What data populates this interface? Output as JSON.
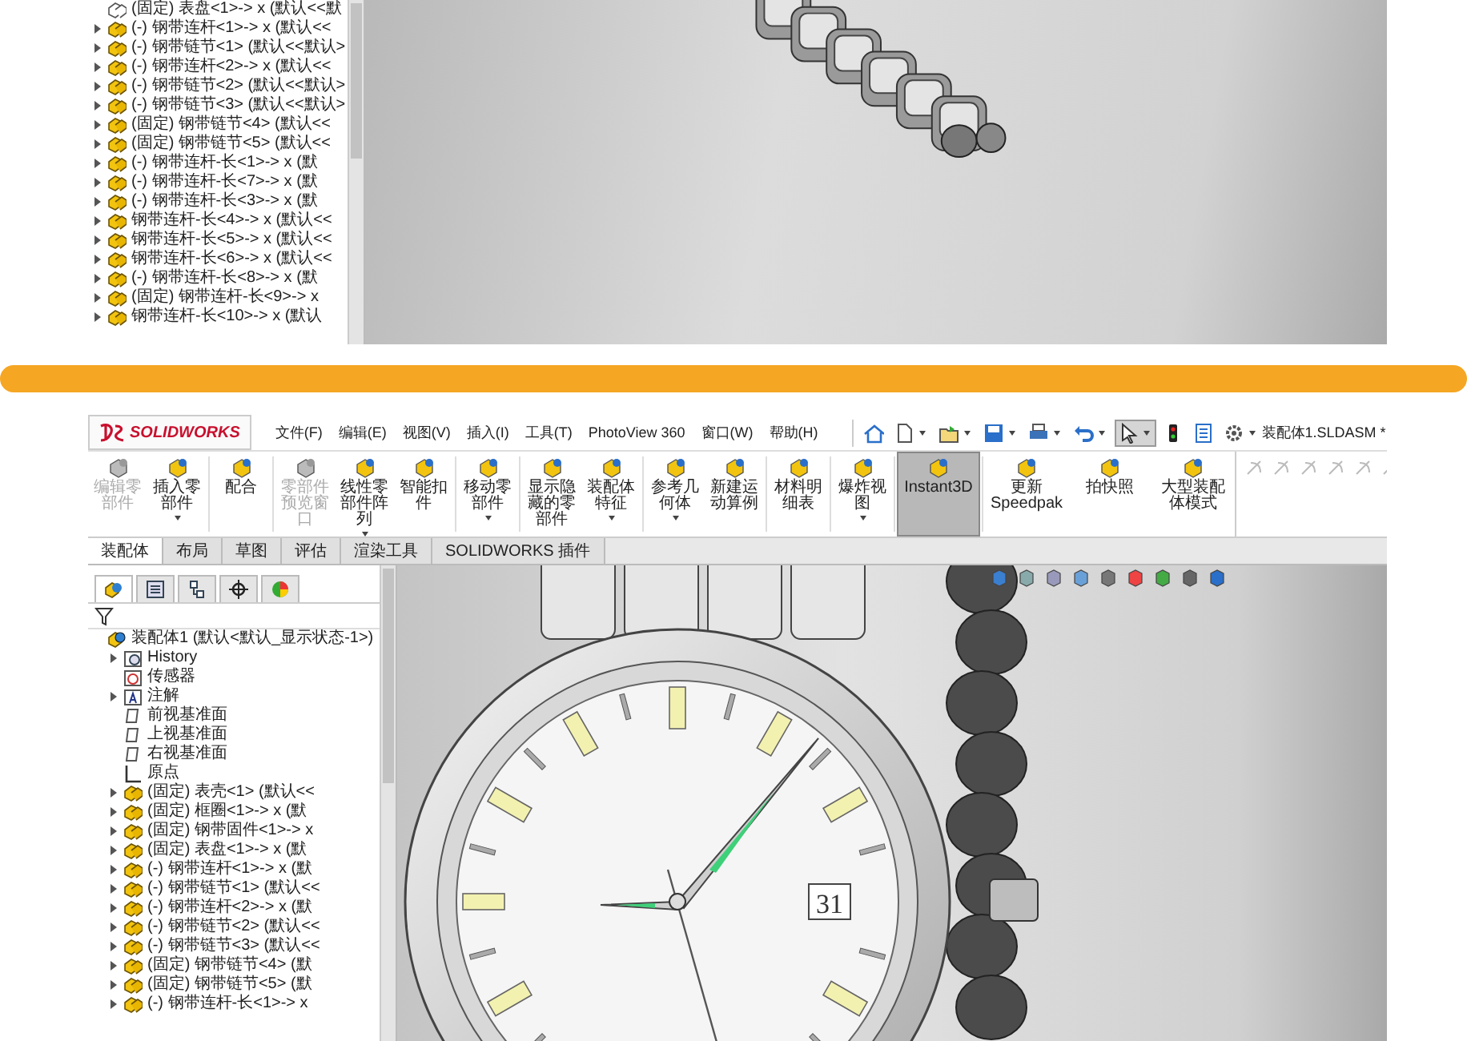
{
  "top_screenshot": {
    "tree": [
      {
        "label": "(固定) 表盘<1>-> x (默认<<默",
        "kind": "hidden-part",
        "expandable": false
      },
      {
        "label": "(-) 钢带连杆<1>-> x (默认<<",
        "kind": "part",
        "expandable": true
      },
      {
        "label": "(-) 钢带链节<1> (默认<<默认>",
        "kind": "part",
        "expandable": true
      },
      {
        "label": "(-) 钢带连杆<2>-> x (默认<<",
        "kind": "part",
        "expandable": true
      },
      {
        "label": "(-) 钢带链节<2> (默认<<默认>",
        "kind": "part",
        "expandable": true
      },
      {
        "label": "(-) 钢带链节<3> (默认<<默认>",
        "kind": "part",
        "expandable": true
      },
      {
        "label": "(固定) 钢带链节<4> (默认<<",
        "kind": "part",
        "expandable": true
      },
      {
        "label": "(固定) 钢带链节<5> (默认<<",
        "kind": "part",
        "expandable": true
      },
      {
        "label": "(-) 钢带连杆-长<1>-> x (默",
        "kind": "part",
        "expandable": true
      },
      {
        "label": "(-) 钢带连杆-长<7>-> x (默",
        "kind": "part",
        "expandable": true
      },
      {
        "label": "(-) 钢带连杆-长<3>-> x (默",
        "kind": "part",
        "expandable": true
      },
      {
        "label": "钢带连杆-长<4>-> x (默认<<",
        "kind": "part",
        "expandable": true
      },
      {
        "label": "钢带连杆-长<5>-> x (默认<<",
        "kind": "part",
        "expandable": true
      },
      {
        "label": "钢带连杆-长<6>-> x (默认<<",
        "kind": "part",
        "expandable": true
      },
      {
        "label": "(-) 钢带连杆-长<8>-> x (默",
        "kind": "part",
        "expandable": true
      },
      {
        "label": "(固定) 钢带连杆-长<9>-> x",
        "kind": "part",
        "expandable": true
      },
      {
        "label": "钢带连杆-长<10>-> x (默认",
        "kind": "part",
        "expandable": true
      }
    ]
  },
  "bottom_screenshot": {
    "logo": "SOLIDWORKS",
    "menu": [
      "文件(F)",
      "编辑(E)",
      "视图(V)",
      "插入(I)",
      "工具(T)",
      "PhotoView 360",
      "窗口(W)",
      "帮助(H)"
    ],
    "quick_access": [
      {
        "kind": "home",
        "dropdown": false,
        "selected": false
      },
      {
        "kind": "new",
        "dropdown": true,
        "selected": false
      },
      {
        "kind": "open",
        "dropdown": true,
        "selected": false
      },
      {
        "kind": "save",
        "dropdown": true,
        "selected": false
      },
      {
        "kind": "print",
        "dropdown": true,
        "selected": false
      },
      {
        "kind": "undo",
        "dropdown": true,
        "selected": false
      },
      {
        "kind": "select",
        "dropdown": true,
        "selected": true
      },
      {
        "kind": "rebuild",
        "dropdown": false,
        "selected": false
      },
      {
        "kind": "options-list",
        "dropdown": false,
        "selected": false
      },
      {
        "kind": "options",
        "dropdown": true,
        "selected": false
      }
    ],
    "document_title": "装配体1.SLDASM *",
    "ribbon": [
      {
        "label": "编辑零部件",
        "disabled": true,
        "dropdown": false,
        "selected": false
      },
      {
        "label": "插入零部件",
        "disabled": false,
        "dropdown": true,
        "selected": false
      },
      {
        "label": "配合",
        "disabled": false,
        "dropdown": false,
        "selected": false
      },
      {
        "label": "零部件预览窗口",
        "disabled": true,
        "dropdown": false,
        "selected": false
      },
      {
        "label": "线性零部件阵列",
        "disabled": false,
        "dropdown": true,
        "selected": false
      },
      {
        "label": "智能扣件",
        "disabled": false,
        "dropdown": false,
        "selected": false
      },
      {
        "label": "移动零部件",
        "disabled": false,
        "dropdown": true,
        "selected": false
      },
      {
        "label": "显示隐藏的零部件",
        "disabled": false,
        "dropdown": false,
        "selected": false
      },
      {
        "label": "装配体特征",
        "disabled": false,
        "dropdown": true,
        "selected": false
      },
      {
        "label": "参考几何体",
        "disabled": false,
        "dropdown": true,
        "selected": false
      },
      {
        "label": "新建运动算例",
        "disabled": false,
        "dropdown": false,
        "selected": false
      },
      {
        "label": "材料明细表",
        "disabled": false,
        "dropdown": false,
        "selected": false
      },
      {
        "label": "爆炸视图",
        "disabled": false,
        "dropdown": true,
        "selected": false
      },
      {
        "label": "Instant3D",
        "disabled": false,
        "dropdown": false,
        "selected": true
      },
      {
        "label": "更新Speedpak",
        "disabled": false,
        "dropdown": false,
        "selected": false
      },
      {
        "label": "拍快照",
        "disabled": false,
        "dropdown": false,
        "selected": false
      },
      {
        "label": "大型装配体模式",
        "disabled": false,
        "dropdown": false,
        "selected": false
      }
    ],
    "tabs": [
      {
        "label": "装配体",
        "selected": true
      },
      {
        "label": "布局",
        "selected": false
      },
      {
        "label": "草图",
        "selected": false
      },
      {
        "label": "评估",
        "selected": false
      },
      {
        "label": "渲染工具",
        "selected": false
      },
      {
        "label": "SOLIDWORKS 插件",
        "selected": false
      }
    ],
    "panel_tabs": [
      {
        "kind": "feature-tree",
        "selected": true
      },
      {
        "kind": "property",
        "selected": false
      },
      {
        "kind": "configuration",
        "selected": false
      },
      {
        "kind": "dimxpert",
        "selected": false
      },
      {
        "kind": "display",
        "selected": false
      }
    ],
    "tree": {
      "label": "装配体1 (默认<默认_显示状态-1>)",
      "kind": "assembly",
      "expandable": false,
      "children": [
        {
          "label": "History",
          "kind": "history",
          "expandable": true
        },
        {
          "label": "传感器",
          "kind": "sensor",
          "expandable": false
        },
        {
          "label": "注解",
          "kind": "annotation",
          "expandable": true
        },
        {
          "label": "前视基准面",
          "kind": "plane",
          "expandable": false
        },
        {
          "label": "上视基准面",
          "kind": "plane",
          "expandable": false
        },
        {
          "label": "右视基准面",
          "kind": "plane",
          "expandable": false
        },
        {
          "label": "原点",
          "kind": "origin",
          "expandable": false
        },
        {
          "label": "(固定) 表壳<1> (默认<<",
          "kind": "part",
          "expandable": true
        },
        {
          "label": "(固定) 框圈<1>-> x (默",
          "kind": "part",
          "expandable": true
        },
        {
          "label": "(固定) 钢带固件<1>-> x",
          "kind": "part",
          "expandable": true
        },
        {
          "label": "(固定) 表盘<1>-> x (默",
          "kind": "part",
          "expandable": true
        },
        {
          "label": "(-) 钢带连杆<1>-> x (默",
          "kind": "part",
          "expandable": true
        },
        {
          "label": "(-) 钢带链节<1> (默认<<",
          "kind": "part",
          "expandable": true
        },
        {
          "label": "(-) 钢带连杆<2>-> x (默",
          "kind": "part",
          "expandable": true
        },
        {
          "label": "(-) 钢带链节<2> (默认<<",
          "kind": "part",
          "expandable": true
        },
        {
          "label": "(-) 钢带链节<3> (默认<<",
          "kind": "part",
          "expandable": true
        },
        {
          "label": "(固定) 钢带链节<4> (默",
          "kind": "part",
          "expandable": true
        },
        {
          "label": "(固定) 钢带链节<5> (默",
          "kind": "part",
          "expandable": true
        },
        {
          "label": "(-) 钢带连杆-长<1>-> x",
          "kind": "part",
          "expandable": true
        }
      ]
    },
    "date_window": "31"
  }
}
